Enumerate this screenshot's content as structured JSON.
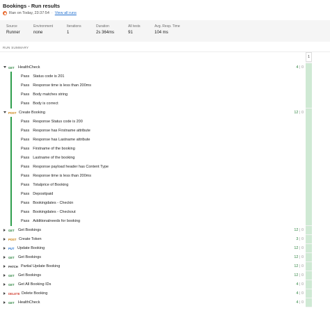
{
  "header": {
    "title": "Bookings - Run results",
    "run_text": "Ran on Today, 23:37:54",
    "separator": "·",
    "view_all_label": "View all runs"
  },
  "summary": [
    {
      "label": "Source",
      "value": "Runner"
    },
    {
      "label": "Environment",
      "value": "none"
    },
    {
      "label": "Iterations",
      "value": "1"
    },
    {
      "label": "Duration",
      "value": "2s 364ms"
    },
    {
      "label": "All tests",
      "value": "91"
    },
    {
      "label": "Avg. Resp. Time",
      "value": "104 ms"
    }
  ],
  "run_summary_label": "RUN SUMMARY",
  "iteration_column_label": "1",
  "pass_label": "Pass",
  "colors": {
    "pass_green": "#2e9e4d",
    "get": "#2e8540",
    "post": "#c77900",
    "put": "#1f6fd0",
    "delete": "#d23f31"
  },
  "requests": [
    {
      "method": "GET",
      "name": "HealthCheck",
      "pass": "4",
      "fail": "0",
      "expanded": true,
      "tests": [
        "Status code is 201",
        "Response time is less than 200ms",
        "Body matches string",
        "Body is correct"
      ]
    },
    {
      "method": "POST",
      "name": "Create Booking",
      "pass": "12",
      "fail": "0",
      "expanded": true,
      "tests": [
        "Response Status code is 200",
        "Response has Firstname attribute",
        "Response has Lastname attribute",
        "Firstname of the booking",
        "Lastname of the booking",
        "Response payload header has Content Type",
        "Response time is less than 200ms",
        "Totalprice of Booking",
        "Depositpaid",
        "Bookingdates - Checkin",
        "Bookingdates - Checkout",
        "Additionalneeds for booking"
      ]
    },
    {
      "method": "GET",
      "name": "Get Bookings",
      "pass": "12",
      "fail": "0",
      "expanded": false,
      "tests": []
    },
    {
      "method": "POST",
      "name": "Create Token",
      "pass": "3",
      "fail": "0",
      "expanded": false,
      "tests": []
    },
    {
      "method": "PUT",
      "name": "Update Booking",
      "pass": "12",
      "fail": "0",
      "expanded": false,
      "tests": []
    },
    {
      "method": "GET",
      "name": "Get Bookings",
      "pass": "12",
      "fail": "0",
      "expanded": false,
      "tests": []
    },
    {
      "method": "PATCH",
      "name": "Partial Update Booking",
      "pass": "12",
      "fail": "0",
      "expanded": false,
      "tests": []
    },
    {
      "method": "GET",
      "name": "Get Bookings",
      "pass": "12",
      "fail": "0",
      "expanded": false,
      "tests": []
    },
    {
      "method": "GET",
      "name": "Get All Booking IDs",
      "pass": "4",
      "fail": "0",
      "expanded": false,
      "tests": []
    },
    {
      "method": "DELETE",
      "name": "Delete Booking",
      "pass": "4",
      "fail": "0",
      "expanded": false,
      "tests": []
    },
    {
      "method": "GET",
      "name": "HealthCheck",
      "pass": "4",
      "fail": "0",
      "expanded": false,
      "tests": []
    }
  ]
}
